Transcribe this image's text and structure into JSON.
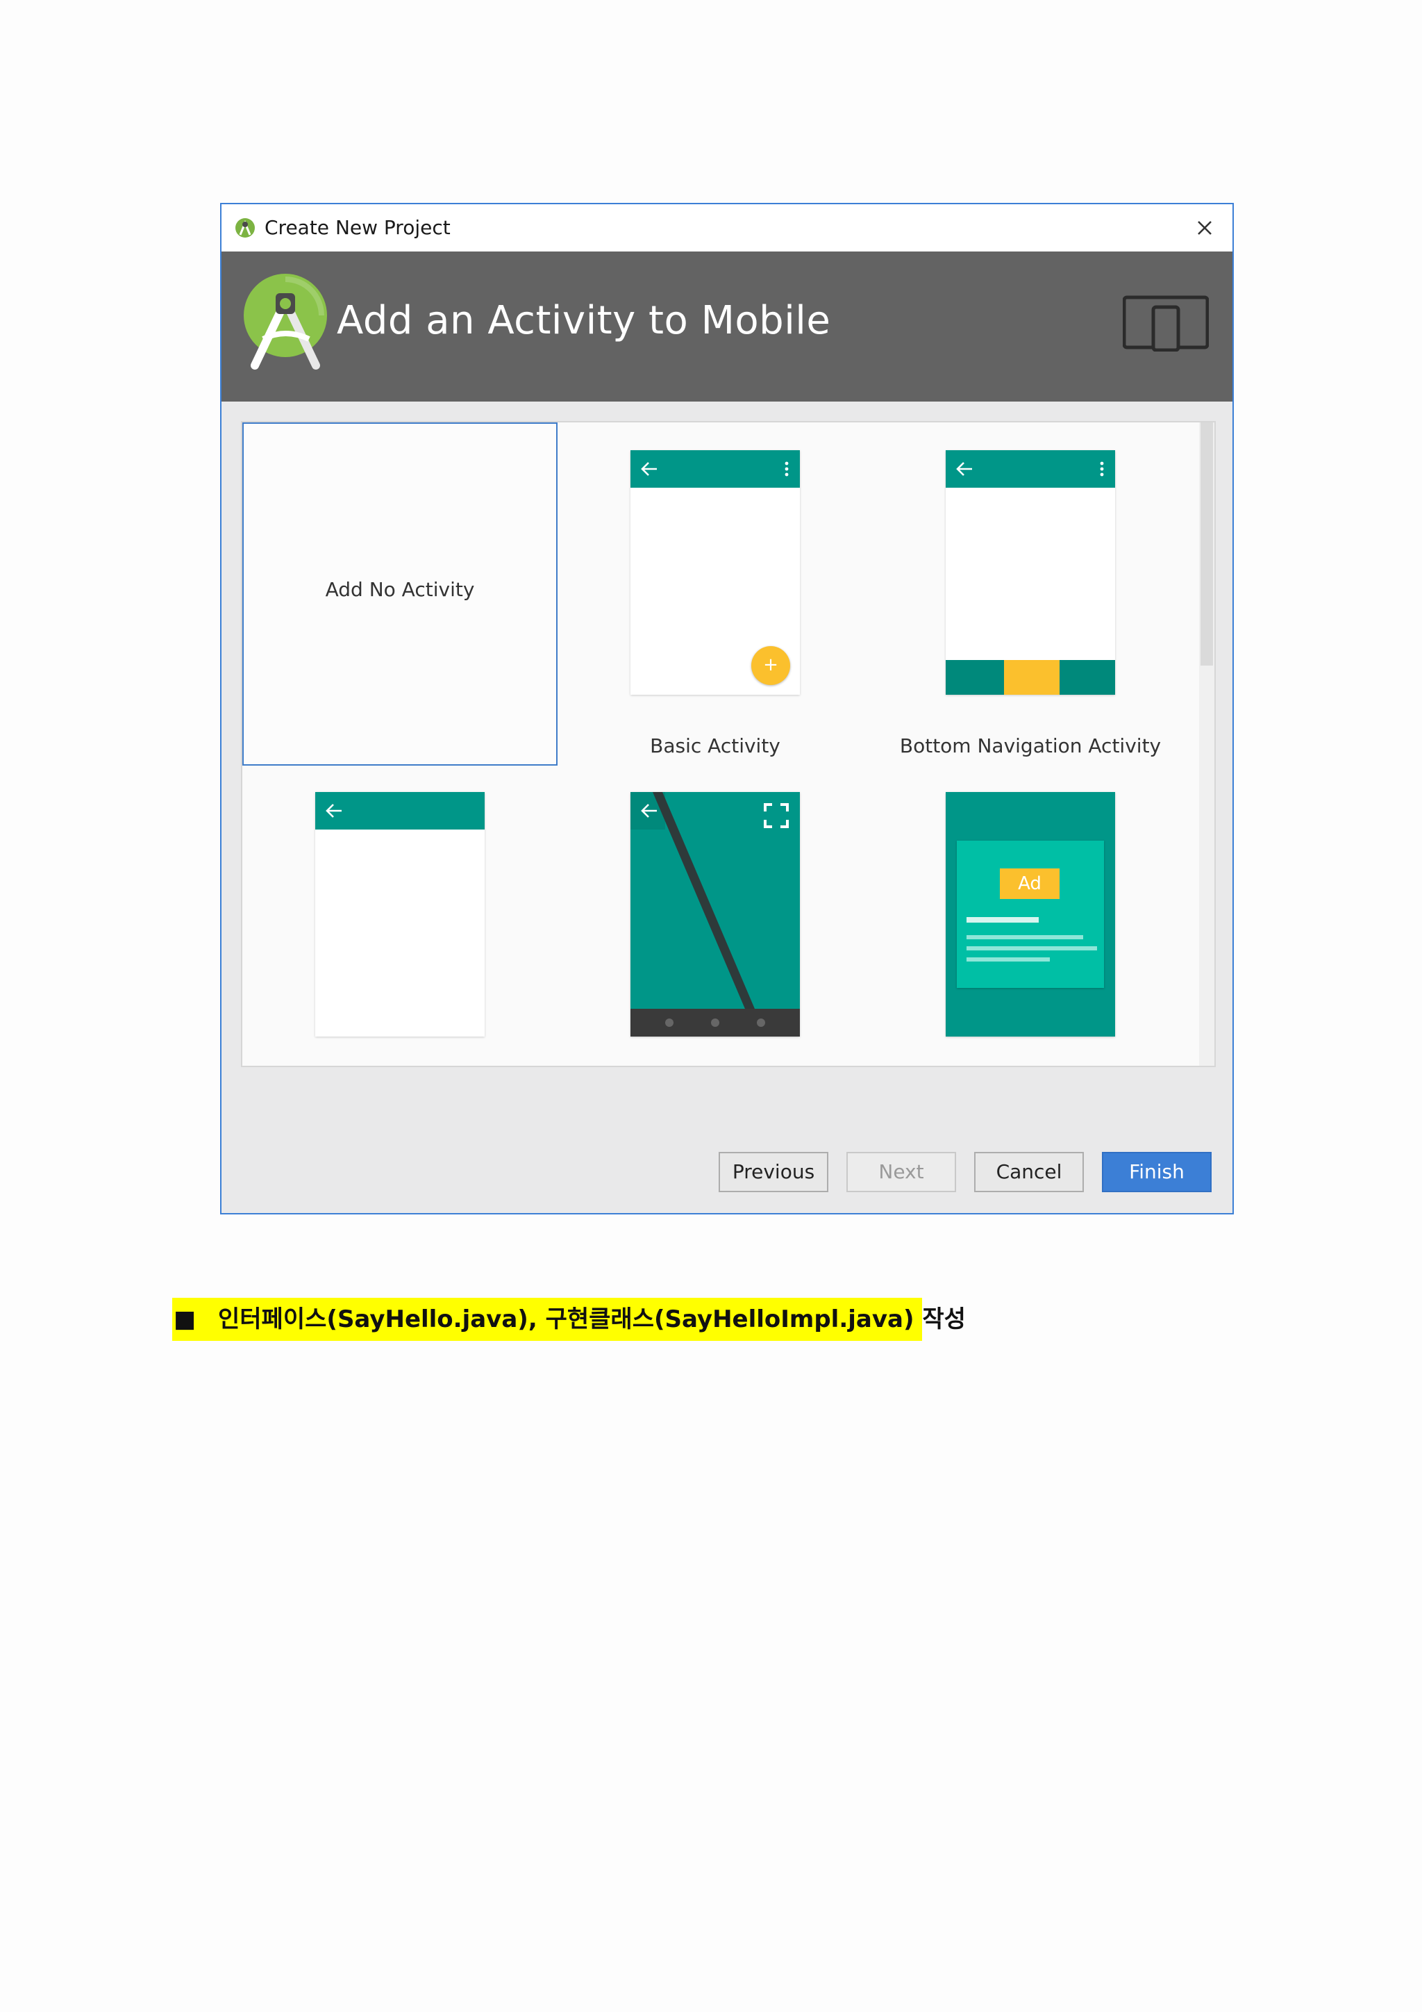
{
  "dialog": {
    "title": "Create New Project",
    "heading": "Add an Activity to Mobile",
    "icons": {
      "app": "android-studio-icon",
      "close": "close-icon",
      "logo": "android-studio-logo",
      "device": "phone-tablet-device-icon"
    }
  },
  "gallery": {
    "tiles": [
      {
        "label": "Add No Activity",
        "selected": true
      },
      {
        "label": "Basic Activity"
      },
      {
        "label": "Bottom Navigation Activity"
      },
      {
        "label": ""
      },
      {
        "label": ""
      },
      {
        "label": ""
      }
    ],
    "ad_badge": "Ad",
    "fab_glyph": "+"
  },
  "buttons": {
    "previous": "Previous",
    "next": "Next",
    "cancel": "Cancel",
    "finish": "Finish"
  },
  "note": {
    "bullet": "■",
    "text": "인터페이스(SayHello.java), 구현클래스(SayHelloImpl.java) 작성"
  },
  "colors": {
    "accent_teal": "#009688",
    "accent_yellow": "#fbc02d",
    "header_gray": "#636363",
    "primary_blue": "#3c7fd6",
    "highlight": "#ffff00"
  }
}
